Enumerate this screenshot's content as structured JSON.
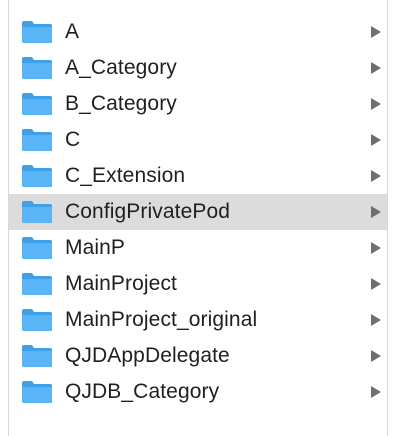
{
  "items": [
    {
      "label": "A",
      "icon": "folder-icon",
      "selected": false
    },
    {
      "label": "A_Category",
      "icon": "folder-icon",
      "selected": false
    },
    {
      "label": "B_Category",
      "icon": "folder-icon",
      "selected": false
    },
    {
      "label": "C",
      "icon": "folder-icon",
      "selected": false
    },
    {
      "label": "C_Extension",
      "icon": "folder-icon",
      "selected": false
    },
    {
      "label": "ConfigPrivatePod",
      "icon": "folder-icon",
      "selected": true
    },
    {
      "label": "MainP",
      "icon": "folder-icon",
      "selected": false
    },
    {
      "label": "MainProject",
      "icon": "folder-icon",
      "selected": false
    },
    {
      "label": "MainProject_original",
      "icon": "folder-icon",
      "selected": false
    },
    {
      "label": "QJDAppDelegate",
      "icon": "folder-icon",
      "selected": false
    },
    {
      "label": "QJDB_Category",
      "icon": "folder-icon",
      "selected": false
    }
  ],
  "colors": {
    "folder_body": "#5ab4f5",
    "folder_tab": "#3fa0ea",
    "selection": "#dcdcdc",
    "chevron": "#6e6e6e"
  }
}
